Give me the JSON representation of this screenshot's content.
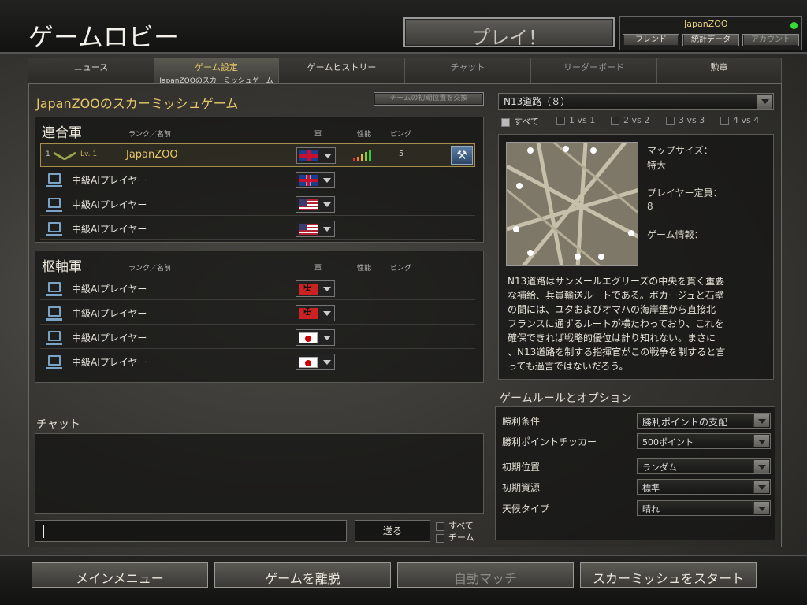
{
  "header": {
    "title": "ゲームロビー",
    "play_label": "プレイ！",
    "username": "JapanZOO",
    "links": [
      "フレンド",
      "統計データ",
      "アカウント"
    ]
  },
  "tabs": [
    {
      "label": "ニュース",
      "sub": ""
    },
    {
      "label": "ゲーム設定",
      "sub": "JapanZOOのスカーミッシュゲーム"
    },
    {
      "label": "ゲームヒストリー",
      "sub": ""
    },
    {
      "label": "チャット",
      "sub": ""
    },
    {
      "label": "リーダーボード",
      "sub": ""
    },
    {
      "label": "勲章",
      "sub": ""
    }
  ],
  "game": {
    "title": "JapanZOOのスカーミッシュゲーム",
    "reset_button": "チームの初期位置を交換"
  },
  "columns": {
    "rank_name": "ランク／名前",
    "army": "軍",
    "perf": "性能",
    "ping": "ピング"
  },
  "allies": {
    "title": "連合軍",
    "host": {
      "num": "1",
      "level": "Lv. 1",
      "name": "JapanZOO",
      "ping": "5",
      "flag": "uk"
    },
    "players": [
      {
        "name": "中級AIプレイヤー",
        "flag": "uk"
      },
      {
        "name": "中級AIプレイヤー",
        "flag": "us"
      },
      {
        "name": "中級AIプレイヤー",
        "flag": "us"
      }
    ]
  },
  "axis": {
    "title": "枢軸軍",
    "players": [
      {
        "name": "中級AIプレイヤー",
        "flag": "de"
      },
      {
        "name": "中級AIプレイヤー",
        "flag": "de"
      },
      {
        "name": "中級AIプレイヤー",
        "flag": "jp"
      },
      {
        "name": "中級AIプレイヤー",
        "flag": "jp"
      }
    ]
  },
  "chat": {
    "title": "チャット",
    "send_label": "送る",
    "scope_all": "すべて",
    "scope_team": "チーム"
  },
  "map": {
    "selected": "N13道路（８）",
    "filters": [
      "すべて",
      "1 vs 1",
      "2 vs 2",
      "3 vs 3",
      "4 vs 4"
    ],
    "size_label": "マップサイズ：",
    "size_value": "特大",
    "capacity_label": "プレイヤー定員：",
    "capacity_value": "8",
    "info_label": "ゲーム情報：",
    "description_lines": [
      "N13道路はサンメールエグリーズの中央を貫く重要",
      "な補給、兵員輸送ルートである。ボカージュと石壁",
      "の間には、ユタおよびオマハの海岸堡から直接北",
      "フランスに通ずるルートが横たわっており、これを",
      "確保できれば戦略的優位は計り知れない。まさに",
      "、N13道路を制する指揮官がこの戦争を制すると言",
      "っても過言ではないだろう。"
    ]
  },
  "rules": {
    "title": "ゲームルールとオプション",
    "items": [
      {
        "label": "勝利条件",
        "value": "勝利ポイントの支配"
      },
      {
        "label": "勝利ポイントチッカー",
        "value": "500ポイント"
      },
      {
        "label": "初期位置",
        "value": "ランダム"
      },
      {
        "label": "初期資源",
        "value": "標準"
      },
      {
        "label": "天候タイプ",
        "value": "晴れ"
      }
    ]
  },
  "footer": {
    "main_menu": "メインメニュー",
    "leave": "ゲームを離脱",
    "auto_match": "自動マッチ",
    "start": "スカーミッシュをスタート"
  }
}
